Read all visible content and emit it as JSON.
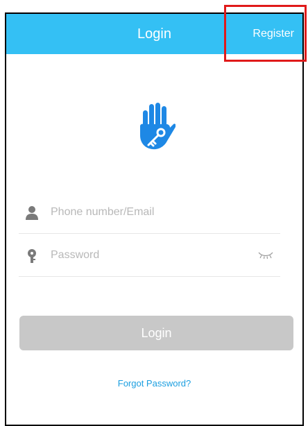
{
  "header": {
    "title": "Login",
    "register_label": "Register",
    "background_color": "#34c0f4"
  },
  "logo": {
    "icon": "hand-key-icon",
    "color": "#1e88e5"
  },
  "form": {
    "phone_placeholder": "Phone number/Email",
    "phone_value": "",
    "phone_icon": "person-icon",
    "password_placeholder": "Password",
    "password_value": "",
    "password_icon": "key-icon",
    "visibility_icon": "eye-closed-icon"
  },
  "actions": {
    "login_label": "Login",
    "login_enabled": false,
    "forgot_label": "Forgot Password?"
  },
  "highlight": {
    "target": "register-link",
    "color": "#e01a1a"
  }
}
